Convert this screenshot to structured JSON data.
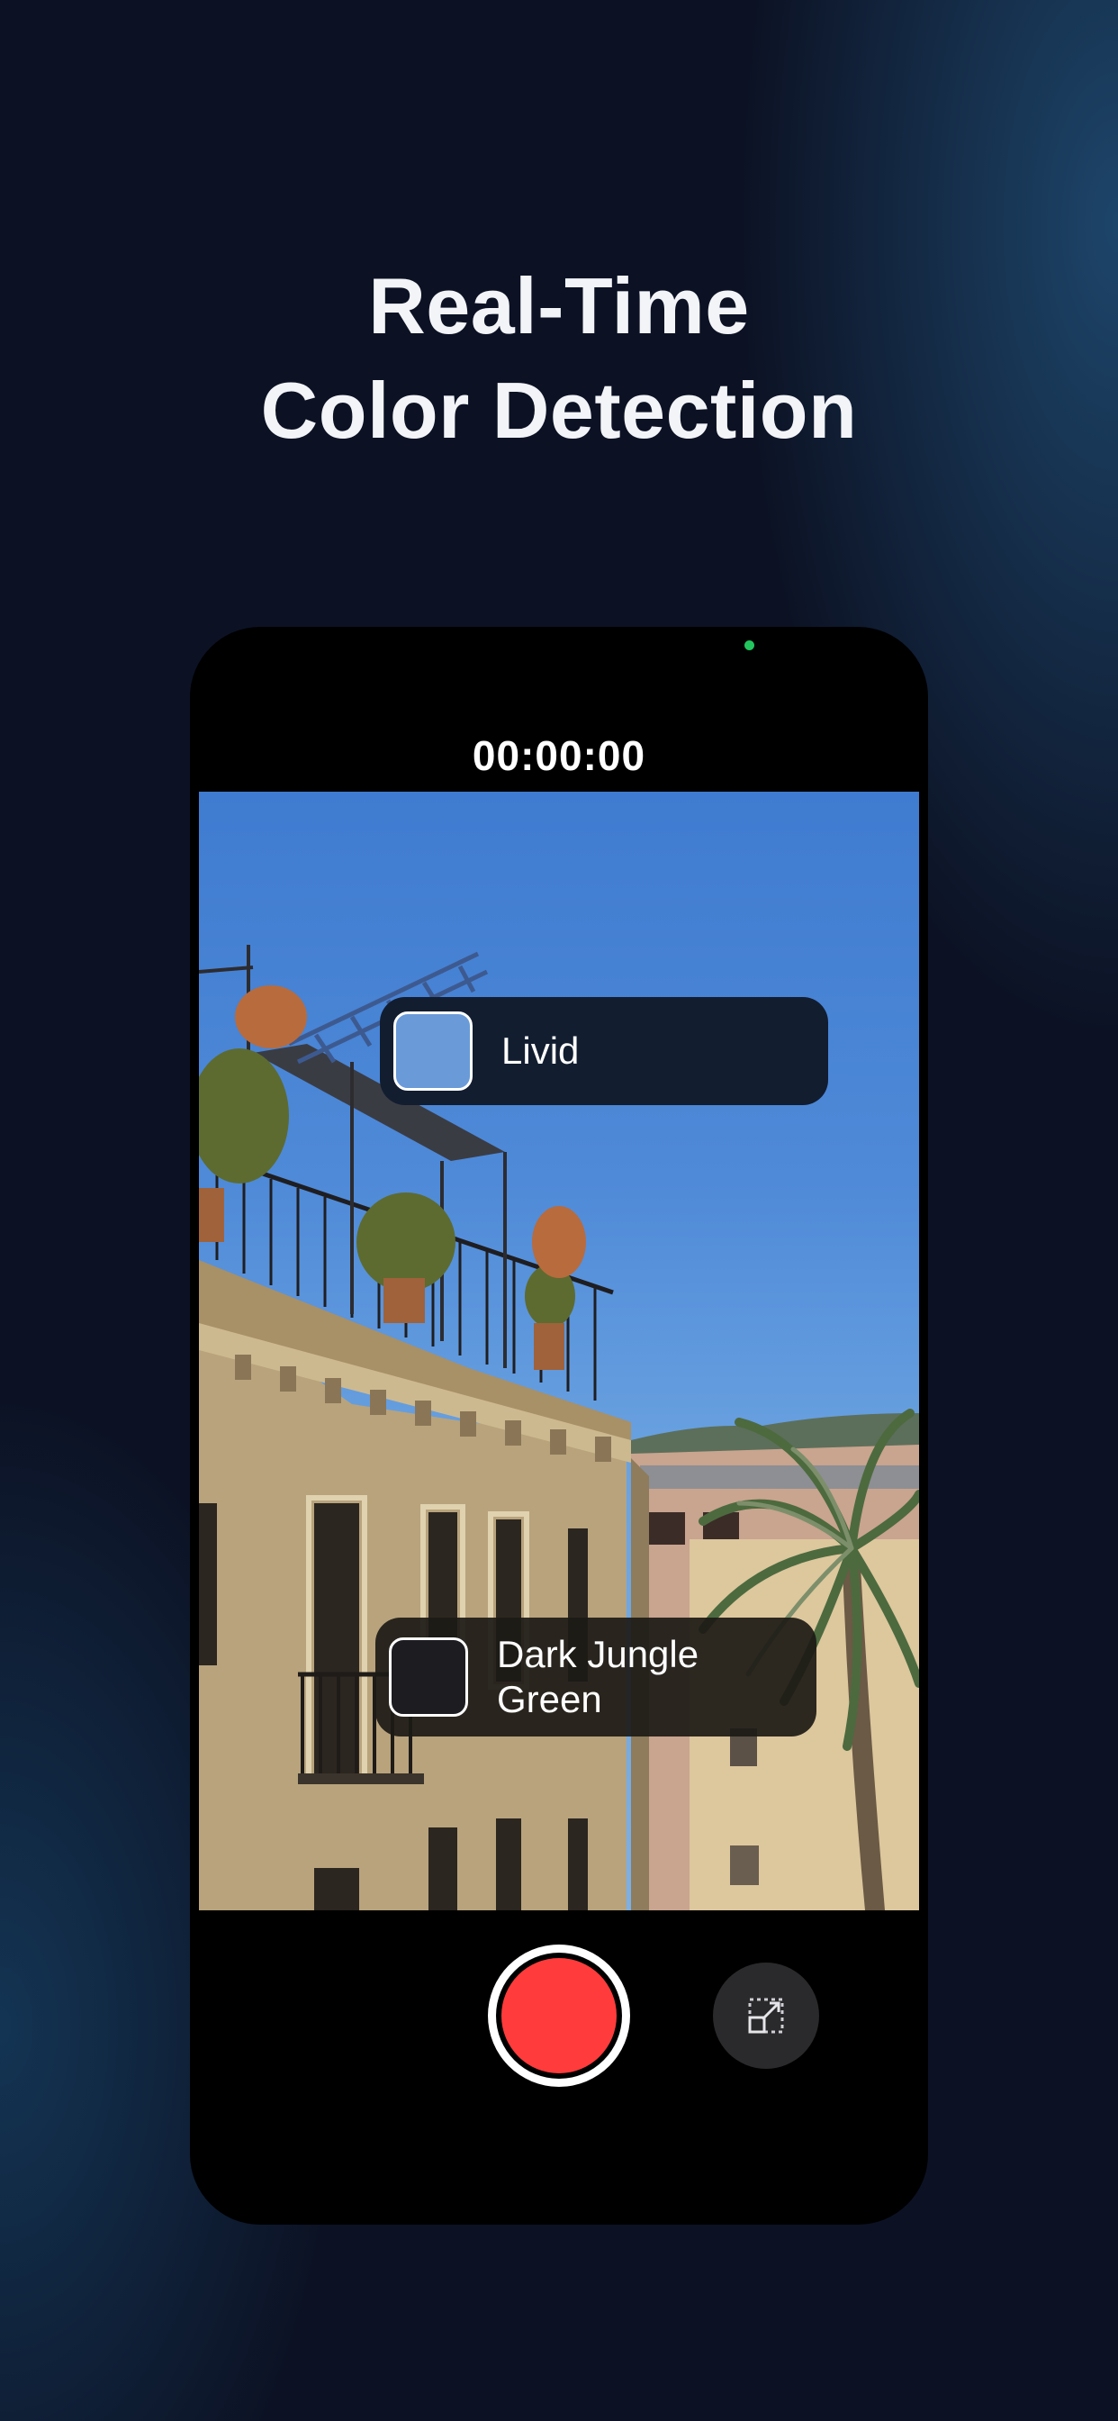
{
  "headline": {
    "line1": "Real-Time",
    "line2": "Color Detection"
  },
  "camera": {
    "timer": "00:00:00",
    "recording_indicator_color": "#22c55e"
  },
  "detections": [
    {
      "label": "Livid",
      "swatch_color": "#6a9ad8"
    },
    {
      "label": "Dark Jungle\nGreen",
      "swatch_color": "#1d1c21"
    }
  ],
  "controls": {
    "record_color": "#ff3b3b",
    "expand_icon": "expand-icon"
  },
  "colors": {
    "background": "#0c1224",
    "phone": "#000000",
    "tag_dark": "#121d30"
  }
}
